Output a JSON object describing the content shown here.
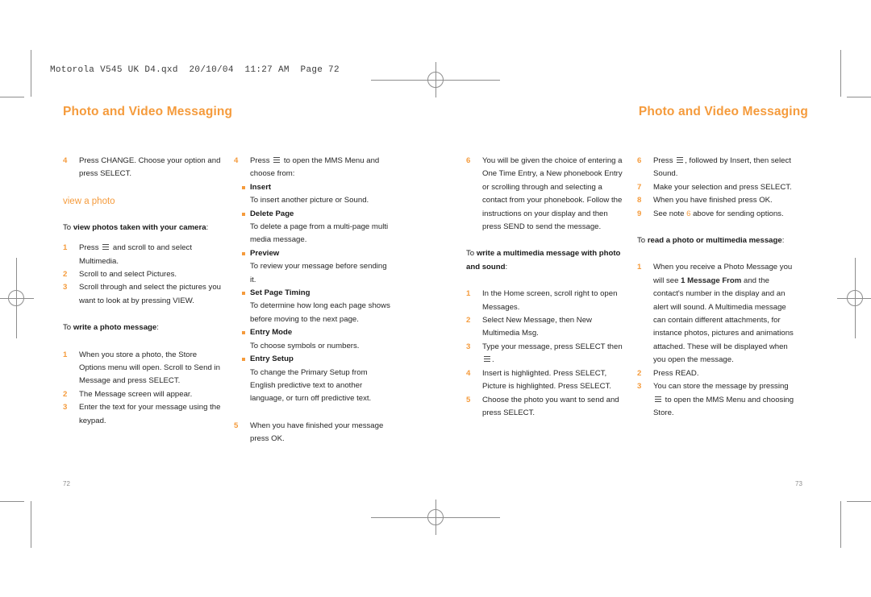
{
  "prepress": {
    "slug": "Motorola V545 UK D4.qxd  20/10/04  11:27 AM  Page 72",
    "registration_mark_name": "registration-crosshair"
  },
  "spread": {
    "left_page": {
      "title": "Photo and Video Messaging",
      "folio": "72",
      "columns": [
        {
          "blocks": [
            {
              "type": "steps",
              "items": [
                {
                  "num": "4",
                  "text": "Press CHANGE. Choose your option and press SELECT."
                }
              ]
            },
            {
              "type": "section_head",
              "text": "view a photo"
            },
            {
              "type": "lead_in",
              "prefix": "To ",
              "bold": "view photos taken with your camera",
              "suffix": ":"
            },
            {
              "type": "steps",
              "items": [
                {
                  "num": "1",
                  "pre": "Press ",
                  "key": "menu-key",
                  "post": " and scroll to and select Multimedia."
                },
                {
                  "num": "2",
                  "text": "Scroll to and select Pictures."
                },
                {
                  "num": "3",
                  "text": "Scroll through and select the pictures you want to look at by pressing VIEW."
                }
              ]
            },
            {
              "type": "lead_in",
              "prefix": "To ",
              "bold": "write a photo message",
              "suffix": ":"
            },
            {
              "type": "steps",
              "items": [
                {
                  "num": "1",
                  "text": "When you store a photo, the Store Options menu will open. Scroll to Send in Message and press SELECT."
                },
                {
                  "num": "2",
                  "text": "The Message screen will appear."
                },
                {
                  "num": "3",
                  "text": "Enter the text for your message using the keypad."
                }
              ]
            }
          ]
        },
        {
          "blocks": [
            {
              "type": "steps",
              "items": [
                {
                  "num": "4",
                  "pre": "Press ",
                  "key": "menu-key",
                  "post": " to open the MMS Menu and choose from:"
                }
              ]
            },
            {
              "type": "bullets",
              "items": [
                {
                  "term": "Insert",
                  "def": "To insert another picture or Sound."
                },
                {
                  "term": "Delete Page",
                  "def": "To delete a page from a multi-page multi media message."
                },
                {
                  "term": "Preview",
                  "def": "To review your message before sending it."
                },
                {
                  "term": "Set Page Timing",
                  "def": "To determine how long each page shows before moving to the next page."
                },
                {
                  "term": "Entry Mode",
                  "def": "To choose symbols or numbers."
                },
                {
                  "term": "Entry Setup",
                  "def": "To change the Primary Setup from English predictive text to another language, or turn off predictive text."
                }
              ]
            },
            {
              "type": "steps",
              "items": [
                {
                  "num": "5",
                  "text": "When you have finished your message press OK."
                }
              ]
            }
          ]
        }
      ]
    },
    "right_page": {
      "title": "Photo and Video Messaging",
      "folio": "73",
      "columns": [
        {
          "blocks": [
            {
              "type": "steps",
              "items": [
                {
                  "num": "6",
                  "text": "You will be given the choice of entering a One Time Entry, a New phonebook Entry or scrolling through and selecting a contact from your phonebook. Follow the instructions on your display and then press SEND to send the message."
                }
              ]
            },
            {
              "type": "lead_in",
              "prefix": "To ",
              "bold": "write a multimedia message with photo and sound",
              "suffix": ":"
            },
            {
              "type": "steps",
              "items": [
                {
                  "num": "1",
                  "text": "In the Home screen, scroll right to open Messages."
                },
                {
                  "num": "2",
                  "text": "Select New Message, then New Multimedia Msg."
                },
                {
                  "num": "3",
                  "pre": "Type your message, press SELECT then ",
                  "key": "menu-key",
                  "post": "."
                },
                {
                  "num": "4",
                  "text": "Insert is highlighted. Press SELECT, Picture is highlighted. Press SELECT."
                },
                {
                  "num": "5",
                  "text": "Choose the photo you want to send and press SELECT."
                }
              ]
            }
          ]
        },
        {
          "blocks": [
            {
              "type": "steps",
              "items": [
                {
                  "num": "6",
                  "pre": "Press ",
                  "key": "menu-key",
                  "post": ", followed by Insert, then select Sound."
                },
                {
                  "num": "7",
                  "text": "Make your selection and press SELECT."
                },
                {
                  "num": "8",
                  "text": "When you have finished press OK."
                },
                {
                  "num": "9",
                  "pre": "See note ",
                  "accent": "6",
                  "post": " above for sending options."
                }
              ]
            },
            {
              "type": "lead_in",
              "prefix": "To ",
              "bold": "read a photo or multimedia message",
              "suffix": ":"
            },
            {
              "type": "steps",
              "items": [
                {
                  "num": "1",
                  "pre": "When you receive a Photo Message you will see ",
                  "strong": "1 Message From",
                  "post": " and the contact's number in the display and an alert will sound. A Multimedia message can contain different attachments, for instance photos, pictures and animations attached. These will be displayed when you open the message."
                },
                {
                  "num": "2",
                  "text": "Press READ."
                },
                {
                  "num": "3",
                  "pre": "You can store the message by pressing ",
                  "key": "menu-key",
                  "post": " to open the MMS Menu and choosing Store."
                }
              ]
            }
          ]
        }
      ]
    }
  },
  "colors": {
    "accent": "#f59b3c",
    "body": "#262626",
    "mark": "#8d8d8d"
  }
}
